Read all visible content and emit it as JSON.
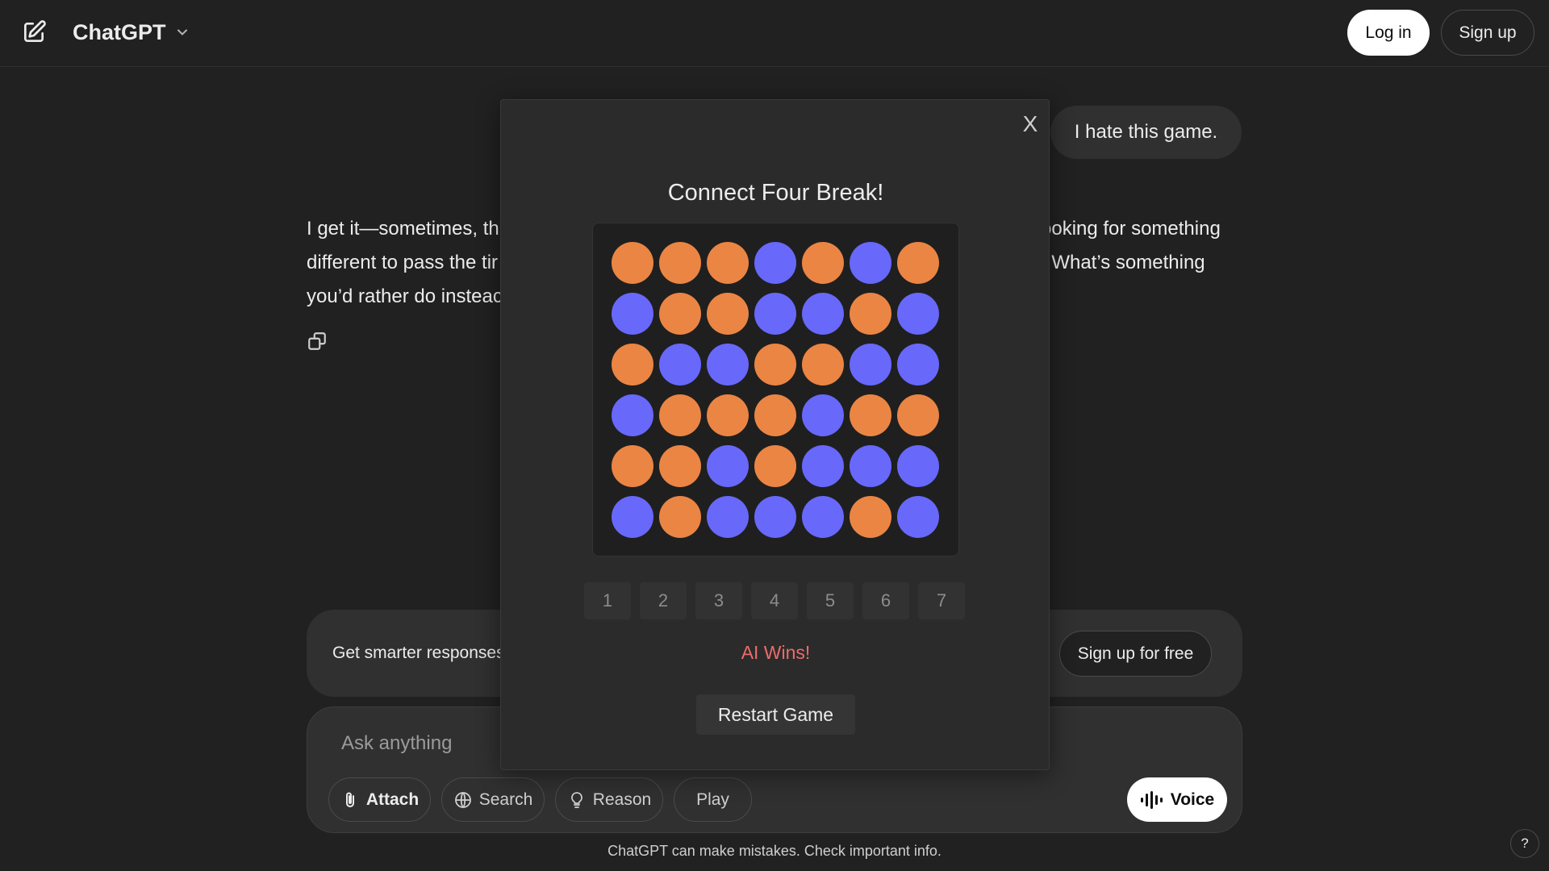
{
  "header": {
    "model_name": "ChatGPT",
    "login_label": "Log in",
    "signup_label": "Sign up"
  },
  "conversation": {
    "user_message": "I hate this game.",
    "assistant_lines": [
      "I get it—sometimes, th",
      "ooking for something",
      "different to pass the tir",
      ". What’s something",
      "you’d rather do insteac"
    ]
  },
  "upsell": {
    "text": "Get smarter responses",
    "button_label": "Sign up for free"
  },
  "composer": {
    "placeholder": "Ask anything",
    "attach_label": "Attach",
    "search_label": "Search",
    "reason_label": "Reason",
    "play_label": "Play",
    "voice_label": "Voice"
  },
  "disclaimer": "ChatGPT can make mistakes. Check important info.",
  "help_label": "?",
  "game": {
    "close_label": "X",
    "title": "Connect Four Break!",
    "colors": {
      "O": "#eb8544",
      "B": "#6868fb"
    },
    "board": [
      [
        "O",
        "O",
        "O",
        "B",
        "O",
        "B",
        "O"
      ],
      [
        "B",
        "O",
        "O",
        "B",
        "B",
        "O",
        "B"
      ],
      [
        "O",
        "B",
        "B",
        "O",
        "O",
        "B",
        "B"
      ],
      [
        "B",
        "O",
        "O",
        "O",
        "B",
        "O",
        "O"
      ],
      [
        "O",
        "O",
        "B",
        "O",
        "B",
        "B",
        "B"
      ],
      [
        "B",
        "O",
        "B",
        "B",
        "B",
        "O",
        "B"
      ]
    ],
    "columns": [
      "1",
      "2",
      "3",
      "4",
      "5",
      "6",
      "7"
    ],
    "result": "AI Wins!",
    "restart_label": "Restart Game"
  }
}
